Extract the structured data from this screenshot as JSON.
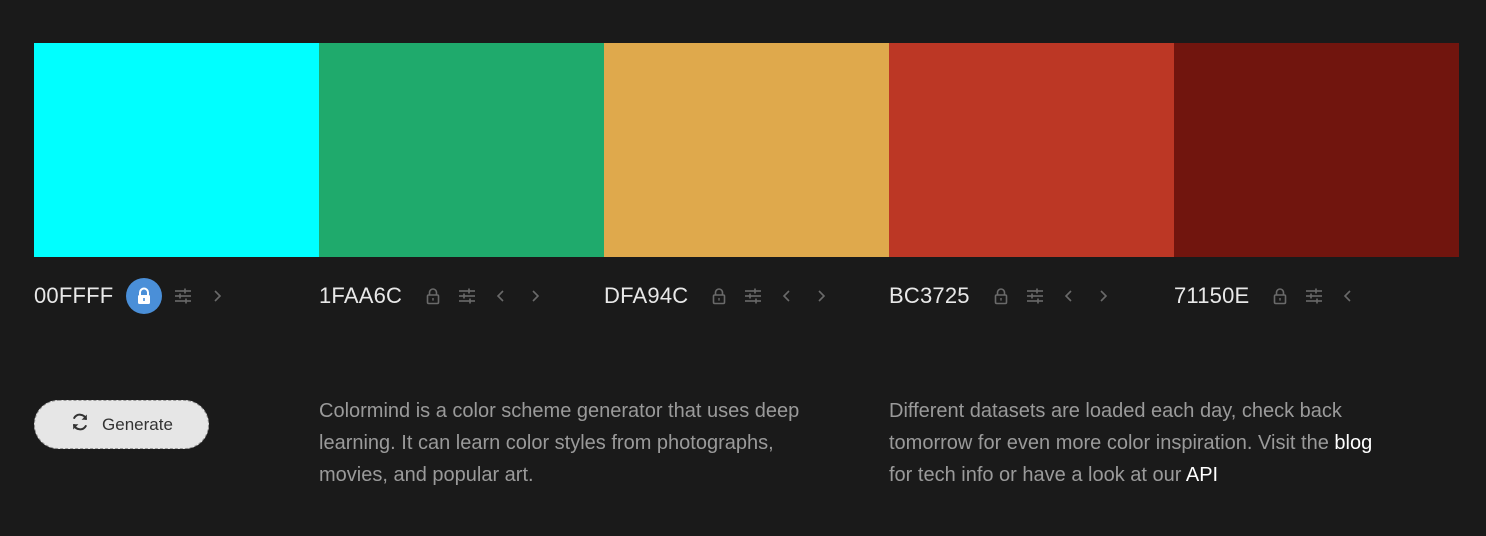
{
  "palette": [
    {
      "hex": "00FFFF",
      "color": "#00FFFF",
      "locked": true,
      "has_left": false,
      "has_right": true
    },
    {
      "hex": "1FAA6C",
      "color": "#1FAA6C",
      "locked": false,
      "has_left": true,
      "has_right": true
    },
    {
      "hex": "DFA94C",
      "color": "#DFA94C",
      "locked": false,
      "has_left": true,
      "has_right": true
    },
    {
      "hex": "BC3725",
      "color": "#BC3725",
      "locked": false,
      "has_left": true,
      "has_right": true
    },
    {
      "hex": "71150E",
      "color": "#71150E",
      "locked": false,
      "has_left": true,
      "has_right": false
    }
  ],
  "icons": {
    "lock": "lock-icon",
    "adjust": "sliders-icon",
    "left": "chevron-left-icon",
    "right": "chevron-right-icon",
    "refresh": "refresh-icon"
  },
  "colors": {
    "background": "#1a1a1a",
    "lock_active": "#4a8fd8",
    "muted_icon": "#6a6a6a",
    "text_light": "#e8e8e8",
    "desc_text": "#9a9a9a"
  },
  "generate": {
    "label": "Generate"
  },
  "about": {
    "text": "Colormind is a color scheme generator that uses deep learning. It can learn color styles from photographs, movies, and popular art."
  },
  "info": {
    "text_before": "Different datasets are loaded each day, check back tomorrow for even more color inspiration. Visit the ",
    "blog_label": "blog",
    "text_middle": " for tech info or have a look at our ",
    "api_label": "API"
  }
}
